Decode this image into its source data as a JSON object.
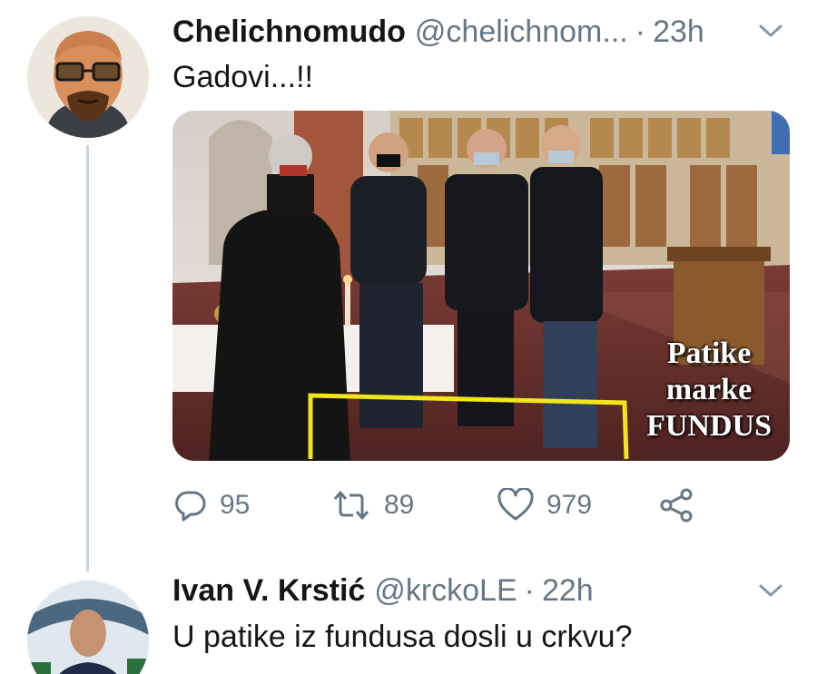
{
  "tweet1": {
    "display_name": "Chelichnomudo",
    "handle": "@chelichnom...",
    "separator": "·",
    "time": "23h",
    "text": "Gadovi...!!",
    "image_caption": {
      "line1": "Patike",
      "line2": "marke",
      "line3": "FUNDUS"
    },
    "stats": {
      "replies": "95",
      "retweets": "89",
      "likes": "979"
    },
    "icons": {
      "reply": "reply-icon",
      "retweet": "retweet-icon",
      "like": "heart-icon",
      "share": "share-icon",
      "menu": "chevron-down-icon"
    }
  },
  "tweet2": {
    "display_name": "Ivan V. Krstić",
    "handle": "@krckoLE",
    "separator": "·",
    "time": "22h",
    "text": "U patike iz fundusa dosli u crkvu?"
  },
  "colors": {
    "text_primary": "#14171a",
    "text_secondary": "#657786",
    "thread_line": "#c9d3dc",
    "highlight_yellow": "#f2e51c"
  }
}
